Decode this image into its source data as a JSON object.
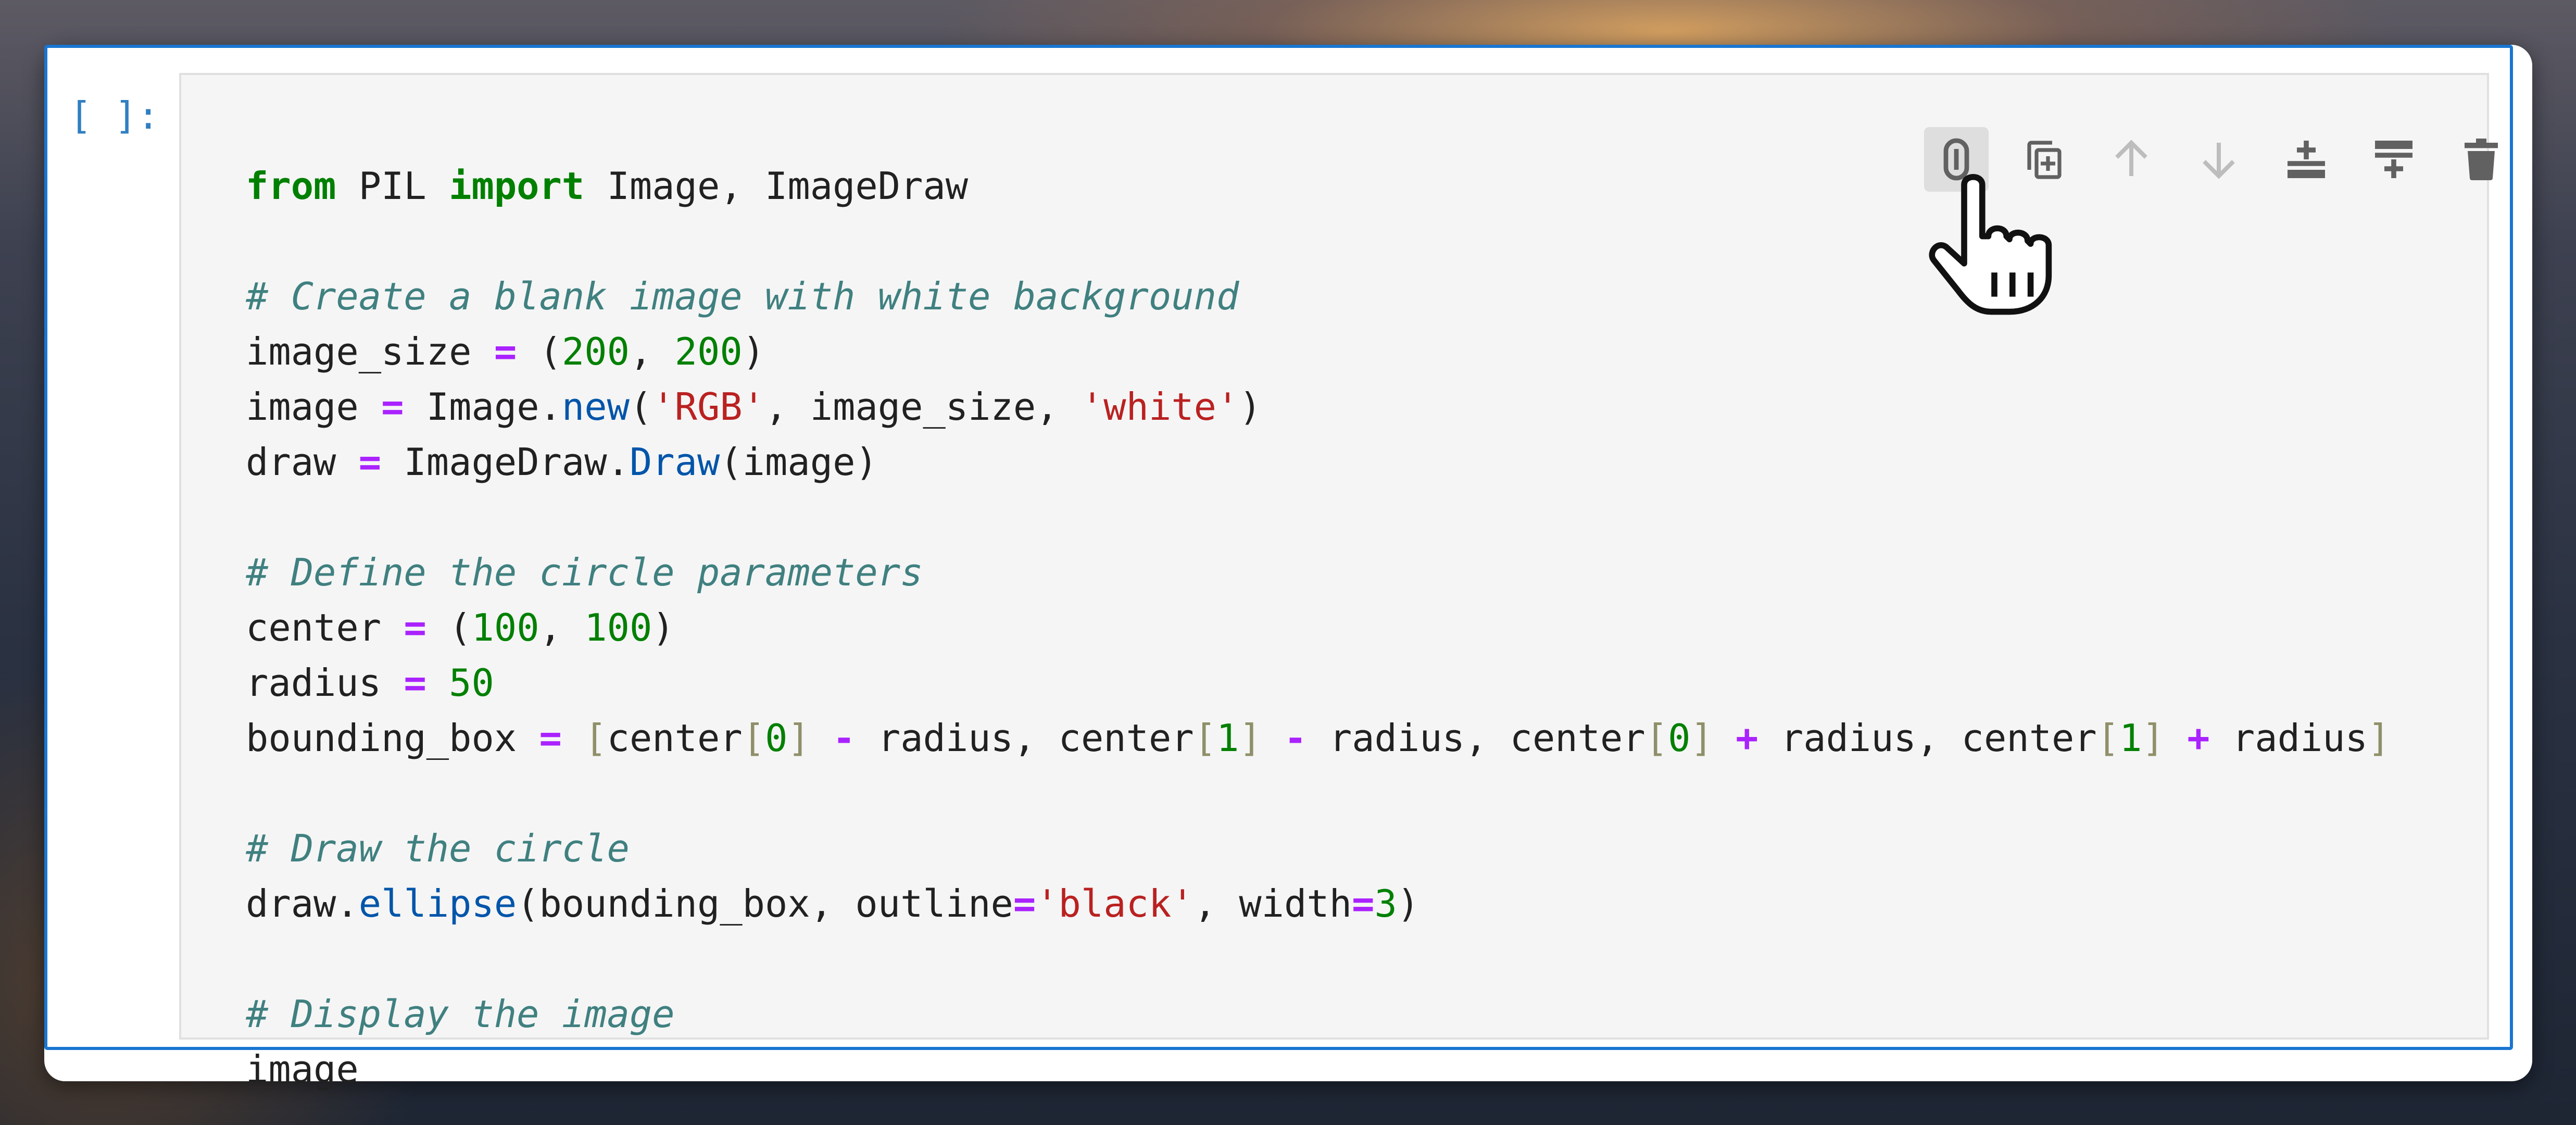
{
  "cell": {
    "prompt": "[ ]:",
    "code_lines": [
      [
        {
          "t": "from",
          "c": "kw"
        },
        {
          "t": " PIL ",
          "c": "plain"
        },
        {
          "t": "import",
          "c": "kw"
        },
        {
          "t": " Image, ImageDraw",
          "c": "plain"
        }
      ],
      [],
      [
        {
          "t": "# Create a blank image with white background",
          "c": "cm"
        }
      ],
      [
        {
          "t": "image_size ",
          "c": "plain"
        },
        {
          "t": "=",
          "c": "op"
        },
        {
          "t": " (",
          "c": "plain"
        },
        {
          "t": "200",
          "c": "num"
        },
        {
          "t": ", ",
          "c": "plain"
        },
        {
          "t": "200",
          "c": "num"
        },
        {
          "t": ")",
          "c": "plain"
        }
      ],
      [
        {
          "t": "image ",
          "c": "plain"
        },
        {
          "t": "=",
          "c": "op"
        },
        {
          "t": " Image.",
          "c": "plain"
        },
        {
          "t": "new",
          "c": "fn"
        },
        {
          "t": "(",
          "c": "plain"
        },
        {
          "t": "'RGB'",
          "c": "str"
        },
        {
          "t": ", image_size, ",
          "c": "plain"
        },
        {
          "t": "'white'",
          "c": "str"
        },
        {
          "t": ")",
          "c": "plain"
        }
      ],
      [
        {
          "t": "draw ",
          "c": "plain"
        },
        {
          "t": "=",
          "c": "op"
        },
        {
          "t": " ImageDraw.",
          "c": "plain"
        },
        {
          "t": "Draw",
          "c": "fn"
        },
        {
          "t": "(image)",
          "c": "plain"
        }
      ],
      [],
      [
        {
          "t": "# Define the circle parameters",
          "c": "cm"
        }
      ],
      [
        {
          "t": "center ",
          "c": "plain"
        },
        {
          "t": "=",
          "c": "op"
        },
        {
          "t": " (",
          "c": "plain"
        },
        {
          "t": "100",
          "c": "num"
        },
        {
          "t": ", ",
          "c": "plain"
        },
        {
          "t": "100",
          "c": "num"
        },
        {
          "t": ")",
          "c": "plain"
        }
      ],
      [
        {
          "t": "radius ",
          "c": "plain"
        },
        {
          "t": "=",
          "c": "op"
        },
        {
          "t": " ",
          "c": "plain"
        },
        {
          "t": "50",
          "c": "num"
        }
      ],
      [
        {
          "t": "bounding_box ",
          "c": "plain"
        },
        {
          "t": "=",
          "c": "op"
        },
        {
          "t": " ",
          "c": "plain"
        },
        {
          "t": "[",
          "c": "br"
        },
        {
          "t": "center",
          "c": "plain"
        },
        {
          "t": "[",
          "c": "br"
        },
        {
          "t": "0",
          "c": "num"
        },
        {
          "t": "]",
          "c": "br"
        },
        {
          "t": " ",
          "c": "plain"
        },
        {
          "t": "-",
          "c": "op"
        },
        {
          "t": " radius, center",
          "c": "plain"
        },
        {
          "t": "[",
          "c": "br"
        },
        {
          "t": "1",
          "c": "num"
        },
        {
          "t": "]",
          "c": "br"
        },
        {
          "t": " ",
          "c": "plain"
        },
        {
          "t": "-",
          "c": "op"
        },
        {
          "t": " radius, center",
          "c": "plain"
        },
        {
          "t": "[",
          "c": "br"
        },
        {
          "t": "0",
          "c": "num"
        },
        {
          "t": "]",
          "c": "br"
        },
        {
          "t": " ",
          "c": "plain"
        },
        {
          "t": "+",
          "c": "op"
        },
        {
          "t": " radius, center",
          "c": "plain"
        },
        {
          "t": "[",
          "c": "br"
        },
        {
          "t": "1",
          "c": "num"
        },
        {
          "t": "]",
          "c": "br"
        },
        {
          "t": " ",
          "c": "plain"
        },
        {
          "t": "+",
          "c": "op"
        },
        {
          "t": " radius",
          "c": "plain"
        },
        {
          "t": "]",
          "c": "br"
        }
      ],
      [],
      [
        {
          "t": "# Draw the circle",
          "c": "cm"
        }
      ],
      [
        {
          "t": "draw.",
          "c": "plain"
        },
        {
          "t": "ellipse",
          "c": "fn"
        },
        {
          "t": "(bounding_box, outline",
          "c": "plain"
        },
        {
          "t": "=",
          "c": "op"
        },
        {
          "t": "'black'",
          "c": "str"
        },
        {
          "t": ", width",
          "c": "plain"
        },
        {
          "t": "=",
          "c": "op"
        },
        {
          "t": "3",
          "c": "num"
        },
        {
          "t": ")",
          "c": "plain"
        }
      ],
      [],
      [
        {
          "t": "# Display the image",
          "c": "cm"
        }
      ],
      [
        {
          "t": "image",
          "c": "plain"
        }
      ]
    ]
  },
  "toolbar": {
    "buttons": [
      {
        "icon": "render-side-by-side-icon",
        "state": "hovered"
      },
      {
        "icon": "duplicate-cell-icon",
        "state": "enabled"
      },
      {
        "icon": "move-up-icon",
        "state": "disabled"
      },
      {
        "icon": "move-down-icon",
        "state": "disabled"
      },
      {
        "icon": "insert-above-icon",
        "state": "enabled"
      },
      {
        "icon": "insert-below-icon",
        "state": "enabled"
      },
      {
        "icon": "delete-cell-icon",
        "state": "enabled"
      }
    ]
  },
  "colors": {
    "cell_border": "#1976d2",
    "prompt": "#307fc1",
    "editor_background": "#f5f5f5",
    "keyword": "#008000",
    "comment": "#408080",
    "number": "#008000",
    "string": "#ba2121",
    "operator": "#aa22ff",
    "function": "#0055aa",
    "bracket": "#8f8f6a",
    "icon_enabled": "#616161",
    "icon_disabled": "#bdbdbd"
  },
  "cursor": {
    "icon": "hand-pointer-icon"
  }
}
